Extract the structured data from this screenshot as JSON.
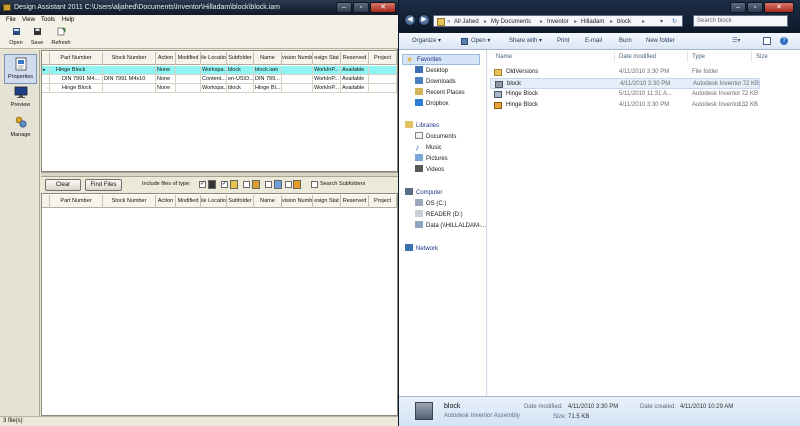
{
  "design_assistant": {
    "title": "Design Assistant 2011 C:\\Users\\aljahed\\Documents\\Inventor\\Hilladam\\block\\block.iam",
    "menu": [
      "File",
      "View",
      "Tools",
      "Help"
    ],
    "toolbar": {
      "open": "Open",
      "save": "Save",
      "refresh": "Refresh"
    },
    "side": {
      "properties": "Properties",
      "preview": "Preview",
      "manage": "Manage"
    },
    "columns": [
      "Part Number",
      "Stock Number",
      "Action",
      "Modified",
      "ile Locatio",
      "Subfolder",
      "Name",
      "vision Numb",
      "esign Stat",
      "Reserved",
      "Project"
    ],
    "rows": [
      {
        "part": "Hinge Block",
        "stock": "",
        "action": "None",
        "modified": "",
        "location": "Workspa...",
        "subfolder": "block",
        "name": "block.iam",
        "revision": "",
        "status": "WorkInP...",
        "reserved": "Available",
        "project": ""
      },
      {
        "part": "DIN 7991 M4...",
        "stock": "DIN 7991 M4x10",
        "action": "None",
        "modified": "",
        "location": "Content...",
        "subfolder": "en-US\\D...",
        "name": "DIN 799...",
        "revision": "",
        "status": "WorkInP...",
        "reserved": "Available",
        "project": ""
      },
      {
        "part": "Hinge Block",
        "stock": "",
        "action": "None",
        "modified": "",
        "location": "Workspa...",
        "subfolder": "block",
        "name": "Hinge Bl...",
        "revision": "",
        "status": "WorkInP...",
        "reserved": "Available",
        "project": ""
      }
    ],
    "find": {
      "clear": "Clear",
      "find_files": "Find Files",
      "include_label": "Include files of type:",
      "search_subfolders": "Search Subfolders"
    },
    "status": "3 file(s)"
  },
  "explorer": {
    "breadcrumb": [
      "All Jahed",
      "My Documents",
      "Inventor",
      "Hilladam",
      "block"
    ],
    "search_placeholder": "Search block",
    "commands": [
      "Organize ▾",
      "Open ▾",
      "Share with ▾",
      "Print",
      "E-mail",
      "Burn",
      "New folder"
    ],
    "nav": {
      "favorites": "Favorites",
      "fav_items": [
        "Desktop",
        "Downloads",
        "Recent Places",
        "Dropbox"
      ],
      "libraries": "Libraries",
      "lib_items": [
        "Documents",
        "Music",
        "Pictures",
        "Videos"
      ],
      "computer": "Computer",
      "comp_items": [
        "OS (C:)",
        "READER (D:)",
        "Data (\\\\HILLALDAM-..."
      ],
      "network": "Network"
    },
    "columns": {
      "name": "Name",
      "date": "Date modified",
      "type": "Type",
      "size": "Size"
    },
    "files": [
      {
        "name": "OldVersions",
        "date": "4/11/2010 3:30 PM",
        "type": "File folder",
        "size": ""
      },
      {
        "name": "block",
        "date": "4/11/2010 3:30 PM",
        "type": "Autodesk Inventor ...",
        "size": "72 KB"
      },
      {
        "name": "Hinge Block",
        "date": "5/11/2010 11:31 A...",
        "type": "Autodesk Inventor ...",
        "size": "72 KB"
      },
      {
        "name": "Hinge Block",
        "date": "4/11/2010 3:30 PM",
        "type": "Autodesk Inventor ...",
        "size": "132 KB"
      }
    ],
    "details": {
      "name": "block",
      "type": "Autodesk Inventor Assembly",
      "modified_label": "Date modified:",
      "modified": "4/11/2010 3:30 PM",
      "size_label": "Size:",
      "size": "71.5 KB",
      "created_label": "Date created:",
      "created": "4/11/2010 10:29 AM"
    }
  },
  "colors": {
    "selected_row": "#8ff4f4",
    "explorer_accent": "#1e395b"
  }
}
